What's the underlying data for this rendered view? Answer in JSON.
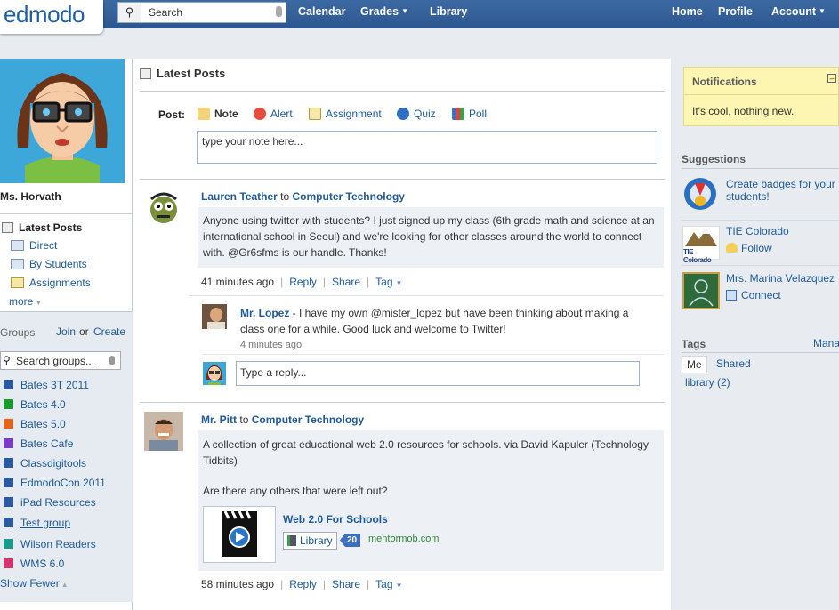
{
  "header": {
    "logo": "edmodo",
    "search_placeholder": "Search",
    "nav_left": [
      "Calendar",
      "Grades",
      "Library"
    ],
    "nav_right": [
      "Home",
      "Profile",
      "Account"
    ]
  },
  "profile": {
    "name": "Ms. Horvath"
  },
  "left_nav": {
    "title": "Latest Posts",
    "items": [
      "Direct",
      "By Students",
      "Assignments"
    ],
    "more": "more"
  },
  "groups": {
    "title": "Groups",
    "join": "Join",
    "or": "or",
    "create": "Create",
    "search_placeholder": "Search groups...",
    "items": [
      {
        "name": "Bates 3T 2011",
        "color": "#2d5a9c"
      },
      {
        "name": "Bates 4.0",
        "color": "#1a9a2a"
      },
      {
        "name": "Bates 5.0",
        "color": "#e0631e"
      },
      {
        "name": "Bates Cafe",
        "color": "#7a3cc4"
      },
      {
        "name": "Classdigitools",
        "color": "#2d5a9c"
      },
      {
        "name": "EdmodoCon 2011",
        "color": "#2d5a9c"
      },
      {
        "name": "iPad Resources",
        "color": "#2d5a9c"
      },
      {
        "name": "Test group",
        "color": "#2d5a9c"
      },
      {
        "name": "Wilson Readers",
        "color": "#1a9a8a"
      },
      {
        "name": "WMS 6.0",
        "color": "#d6336c"
      }
    ],
    "show_fewer": "Show Fewer"
  },
  "feed": {
    "title": "Latest Posts",
    "post_label": "Post:",
    "post_types": [
      "Note",
      "Alert",
      "Assignment",
      "Quiz",
      "Poll"
    ],
    "note_placeholder": "type your note here...",
    "posts": [
      {
        "author": "Lauren Teather",
        "to": "to",
        "group": "Computer Technology",
        "text": "Anyone using twitter with students? I just signed up my class (6th grade math and science at an international school in Seoul) and we're looking for other classes around the world to connect with. @Gr6sfms is our handle. Thanks!",
        "time": "41 minutes ago",
        "actions": [
          "Reply",
          "Share",
          "Tag"
        ],
        "reply": {
          "author": "Mr. Lopez",
          "text": " - I have my own @mister_lopez but have been thinking about making a class one for a while. Good luck and welcome to Twitter!",
          "time": "4 minutes ago"
        },
        "reply_placeholder": "Type a reply..."
      },
      {
        "author": "Mr. Pitt",
        "to": "to",
        "group": "Computer Technology",
        "text": "A collection of great educational web 2.0 resources for schools. via David Kapuler (Technology Tidbits)",
        "text2": "Are there any others that were left out?",
        "link_title": "Web 2.0 For Schools",
        "library_label": "Library",
        "library_count": "20",
        "link_domain": "mentormob.com",
        "time": "58 minutes ago",
        "actions": [
          "Reply",
          "Share",
          "Tag"
        ]
      }
    ]
  },
  "notifications": {
    "title": "Notifications",
    "text": "It's cool, nothing new."
  },
  "suggestions": {
    "title": "Suggestions",
    "items": [
      {
        "title": "Create badges for your students!",
        "action": ""
      },
      {
        "title": "TIE Colorado",
        "action": "Follow",
        "logo_text": "TIE Colorado"
      },
      {
        "title": "Mrs. Marina Velazquez",
        "action": "Connect"
      }
    ]
  },
  "tags": {
    "title": "Tags",
    "manage": "Mana",
    "tabs": [
      "Me",
      "Shared"
    ],
    "items": [
      "library (2)"
    ]
  }
}
